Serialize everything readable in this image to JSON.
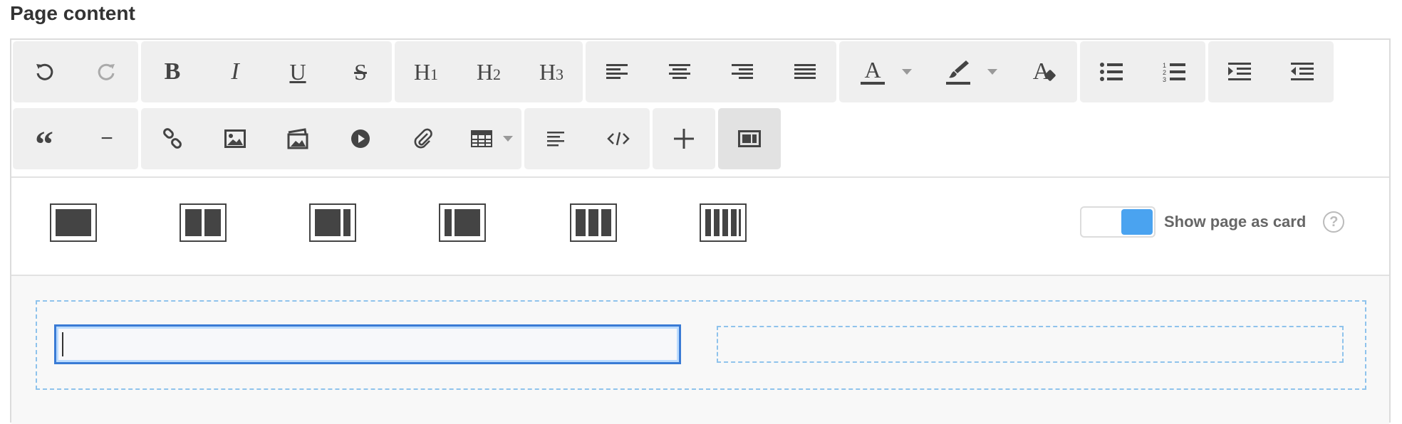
{
  "page": {
    "title": "Page content"
  },
  "toolbar": {
    "row1": [
      {
        "group": "history",
        "buttons": [
          {
            "name": "undo-button",
            "icon": "undo-icon"
          },
          {
            "name": "redo-button",
            "icon": "redo-icon"
          }
        ]
      },
      {
        "group": "text-style",
        "buttons": [
          {
            "name": "bold-button",
            "icon": "bold-icon",
            "glyph": "B"
          },
          {
            "name": "italic-button",
            "icon": "italic-icon",
            "glyph": "I"
          },
          {
            "name": "underline-button",
            "icon": "underline-icon",
            "glyph": "U"
          },
          {
            "name": "strikethrough-button",
            "icon": "strikethrough-icon",
            "glyph": "S"
          }
        ]
      },
      {
        "group": "headings",
        "buttons": [
          {
            "name": "heading1-button",
            "icon": "heading-icon",
            "glyph": "H",
            "sub": "1"
          },
          {
            "name": "heading2-button",
            "icon": "heading-icon",
            "glyph": "H",
            "sub": "2"
          },
          {
            "name": "heading3-button",
            "icon": "heading-icon",
            "glyph": "H",
            "sub": "3"
          }
        ]
      },
      {
        "group": "alignment",
        "buttons": [
          {
            "name": "align-left-button",
            "icon": "align-left-icon"
          },
          {
            "name": "align-center-button",
            "icon": "align-center-icon"
          },
          {
            "name": "align-right-button",
            "icon": "align-right-icon"
          },
          {
            "name": "align-justify-button",
            "icon": "align-justify-icon"
          }
        ]
      },
      {
        "group": "color",
        "buttons": [
          {
            "name": "text-color-button",
            "icon": "text-color-icon",
            "glyph": "A",
            "dropdown": true
          },
          {
            "name": "highlight-color-button",
            "icon": "paint-brush-icon",
            "dropdown": true
          },
          {
            "name": "clear-format-button",
            "icon": "clear-format-icon",
            "glyph": "A"
          }
        ]
      },
      {
        "group": "lists",
        "buttons": [
          {
            "name": "bullet-list-button",
            "icon": "bullet-list-icon"
          },
          {
            "name": "numbered-list-button",
            "icon": "numbered-list-icon"
          }
        ]
      },
      {
        "group": "indent",
        "buttons": [
          {
            "name": "indent-button",
            "icon": "indent-icon"
          },
          {
            "name": "outdent-button",
            "icon": "outdent-icon"
          }
        ]
      }
    ],
    "row2": [
      {
        "group": "blocks",
        "buttons": [
          {
            "name": "blockquote-button",
            "icon": "quote-icon",
            "glyph": "“"
          },
          {
            "name": "horizontal-rule-button",
            "icon": "minus-icon",
            "glyph": "−"
          }
        ]
      },
      {
        "group": "insert",
        "buttons": [
          {
            "name": "link-button",
            "icon": "link-icon"
          },
          {
            "name": "image-button",
            "icon": "image-icon"
          },
          {
            "name": "gallery-button",
            "icon": "gallery-icon"
          },
          {
            "name": "video-button",
            "icon": "play-icon"
          },
          {
            "name": "attachment-button",
            "icon": "paperclip-icon"
          },
          {
            "name": "table-button",
            "icon": "table-icon",
            "dropdown": true
          }
        ]
      },
      {
        "group": "format",
        "buttons": [
          {
            "name": "paragraph-button",
            "icon": "paragraph-icon"
          },
          {
            "name": "code-view-button",
            "icon": "code-icon"
          }
        ]
      },
      {
        "group": "add",
        "buttons": [
          {
            "name": "add-block-button",
            "icon": "plus-icon"
          }
        ]
      },
      {
        "group": "layout",
        "buttons": [
          {
            "name": "layout-toggle-button",
            "icon": "layout-icon",
            "active": true
          }
        ]
      }
    ]
  },
  "layout_options": [
    {
      "name": "layout-one-column",
      "icon": "layout-1col-icon"
    },
    {
      "name": "layout-two-columns",
      "icon": "layout-2col-icon"
    },
    {
      "name": "layout-wide-left",
      "icon": "layout-wide-left-icon"
    },
    {
      "name": "layout-wide-right",
      "icon": "layout-wide-right-icon"
    },
    {
      "name": "layout-three-columns",
      "icon": "layout-3col-icon"
    },
    {
      "name": "layout-four-columns",
      "icon": "layout-4col-icon"
    }
  ],
  "card_toggle": {
    "label": "Show page as card",
    "checked": true,
    "help": "?"
  },
  "colors": {
    "accent": "#4aa3f0",
    "focus_border": "#3a7bd5",
    "dashed": "#8fc3ec",
    "icon": "#444444"
  }
}
